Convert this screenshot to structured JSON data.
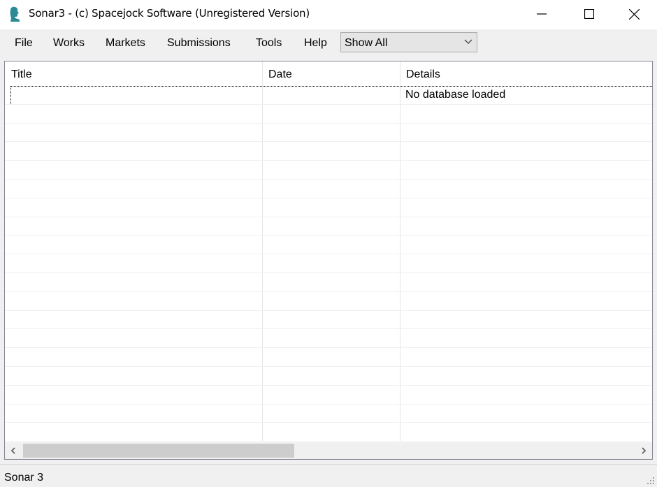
{
  "window": {
    "title": "Sonar3 - (c) Spacejock Software (Unregistered Version)",
    "icon": "app-silhouette-icon",
    "controls": {
      "minimize": "minimize-icon",
      "maximize": "maximize-icon",
      "close": "close-icon"
    }
  },
  "menu": {
    "items": [
      {
        "label": "File"
      },
      {
        "label": "Works"
      },
      {
        "label": "Markets"
      },
      {
        "label": "Submissions"
      },
      {
        "label": "Tools"
      },
      {
        "label": "Help"
      }
    ]
  },
  "filter": {
    "selected": "Show All"
  },
  "list": {
    "columns": [
      {
        "label": "Title"
      },
      {
        "label": "Date"
      },
      {
        "label": "Details"
      }
    ],
    "rows": [
      {
        "title": "",
        "date": "",
        "details": "No database loaded"
      }
    ],
    "empty_row_count": 18
  },
  "status": {
    "text": "Sonar 3"
  },
  "colors": {
    "icon_teal": "#2b8a94",
    "accent_bg": "#f0f0f0",
    "scroll_thumb": "#cdcdcd"
  }
}
